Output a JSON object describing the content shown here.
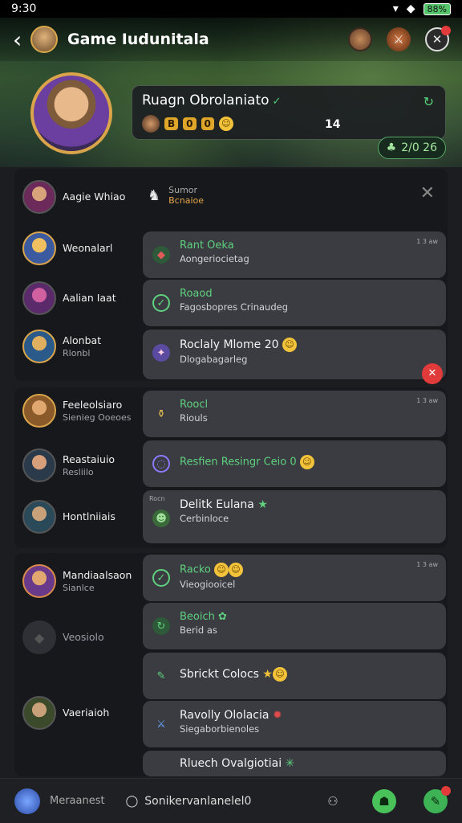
{
  "status": {
    "time": "9:30",
    "battery": "88%"
  },
  "header": {
    "title": "Game Iudunitala",
    "card_name": "Ruagn Obrolaniato",
    "card_count": "14",
    "score": "2/0 26"
  },
  "colors": {
    "accent": "#5fd07e",
    "gold": "#d9a44a",
    "danger": "#e03a3a"
  },
  "groups": [
    {
      "users": [
        {
          "name": "Aagie Whiao",
          "sub": ""
        },
        {
          "name": "Weonalarl",
          "sub": ""
        },
        {
          "name": "Aalian Iaat",
          "sub": ""
        },
        {
          "name": "Alonbat",
          "sub": "Rlonbl"
        }
      ],
      "top_note": {
        "title": "Sumor",
        "sub": "Bcnaioe"
      },
      "messages": [
        {
          "title": "Rant Oeka",
          "sub": "Aongeriocietag",
          "time": "1 3 aw",
          "icon": "gem-icon"
        },
        {
          "title": "Roaod",
          "sub": "Fagosbopres Crinaudeg",
          "time": "",
          "icon": "check-icon"
        },
        {
          "title": "Roclaly Mlome 20",
          "sub": "Dlogabagarleg",
          "time": "",
          "icon": "crystal-icon"
        }
      ]
    },
    {
      "users": [
        {
          "name": "Feeleolsiaro",
          "sub": "Sienieg Ooeoes"
        },
        {
          "name": "Reastaiuio",
          "sub": "Resliilo"
        },
        {
          "name": "Hontlniiais",
          "sub": ""
        }
      ],
      "messages": [
        {
          "title": "Roocl",
          "sub": "Riouls",
          "time": "1 3 aw",
          "icon": "potion-icon"
        },
        {
          "title": "Resfien Resingr Ceio 0",
          "sub": "",
          "time": "",
          "icon": "ring-icon"
        },
        {
          "title": "Delitk Eulana",
          "sub": "Cerbinloce",
          "time": "",
          "icon": "alien-icon",
          "tag": "Rocn"
        }
      ]
    },
    {
      "users": [
        {
          "name": "Mandiaalsaon",
          "sub": "Sianlce"
        },
        {
          "name": "Veosiolo",
          "sub": ""
        },
        {
          "name": "Vaeriaioh",
          "sub": ""
        }
      ],
      "messages": [
        {
          "title": "Racko",
          "sub": "Vieogiooicel",
          "time": "1 3 aw",
          "icon": "check-icon"
        },
        {
          "title": "Beoich",
          "sub": "Berid as",
          "time": "",
          "icon": "refresh-icon"
        },
        {
          "title": "Sbrickt Colocs",
          "sub": "",
          "time": "",
          "icon": "leaf-icon"
        },
        {
          "title": "Ravolly Ololacia",
          "sub": "Siegaborbienoles",
          "time": "",
          "icon": "sword-icon"
        },
        {
          "title": "Rluech Ovalgiotiai",
          "sub": "",
          "time": "",
          "icon": "star-icon"
        }
      ]
    }
  ],
  "bottom": {
    "label": "Meraanest",
    "status": "Sonikervanlanelel0"
  }
}
